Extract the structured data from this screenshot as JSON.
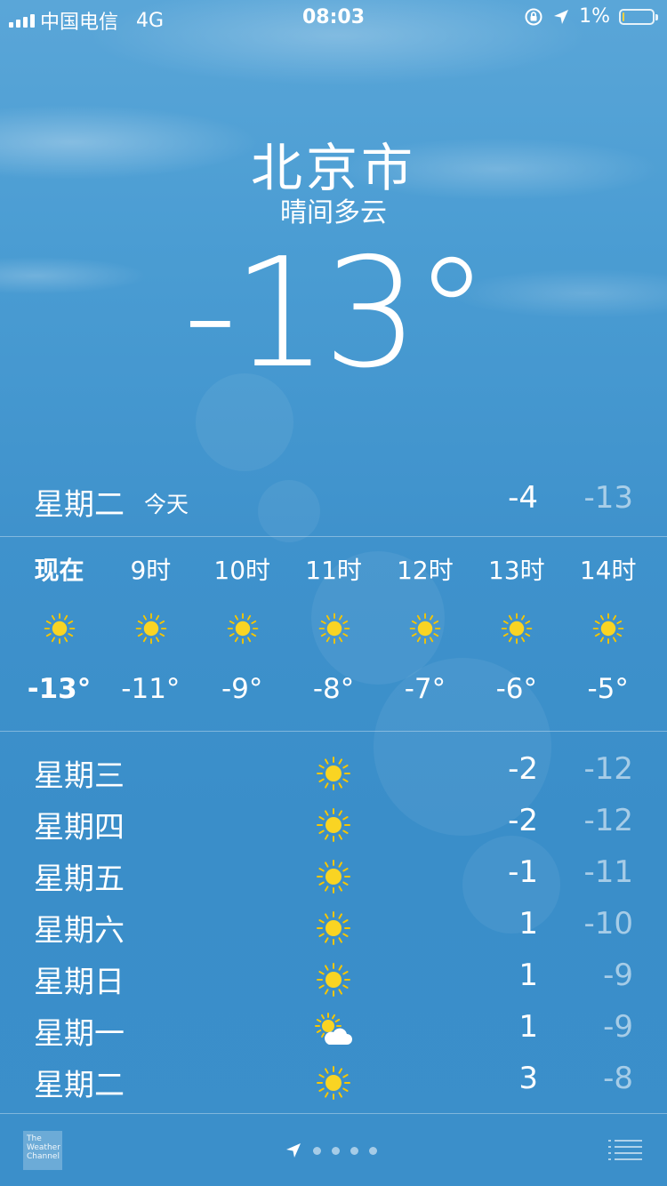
{
  "status_bar": {
    "carrier": "中国电信",
    "network": "4G",
    "time": "08:03",
    "battery": "1%",
    "battery_level": 0.01,
    "icons": [
      "signal-icon",
      "rotation-lock-icon",
      "location-arrow-icon",
      "battery-icon"
    ]
  },
  "location": {
    "city": "北京市",
    "condition": "晴间多云",
    "current_temp": "-13°"
  },
  "today": {
    "day": "星期二",
    "label": "今天",
    "high": "-4",
    "low": "-13"
  },
  "hourly": [
    {
      "time": "现在",
      "icon": "sun-icon",
      "temp": "-13°"
    },
    {
      "time": "9时",
      "icon": "sun-icon",
      "temp": "-11°"
    },
    {
      "time": "10时",
      "icon": "sun-icon",
      "temp": "-9°"
    },
    {
      "time": "11时",
      "icon": "sun-icon",
      "temp": "-8°"
    },
    {
      "time": "12时",
      "icon": "sun-icon",
      "temp": "-7°"
    },
    {
      "time": "13时",
      "icon": "sun-icon",
      "temp": "-6°"
    },
    {
      "time": "14时",
      "icon": "sun-icon",
      "temp": "-5°"
    }
  ],
  "daily": [
    {
      "day": "星期三",
      "icon": "sun-icon",
      "high": "-2",
      "low": "-12"
    },
    {
      "day": "星期四",
      "icon": "sun-icon",
      "high": "-2",
      "low": "-12"
    },
    {
      "day": "星期五",
      "icon": "sun-icon",
      "high": "-1",
      "low": "-11"
    },
    {
      "day": "星期六",
      "icon": "sun-icon",
      "high": "1",
      "low": "-10"
    },
    {
      "day": "星期日",
      "icon": "sun-icon",
      "high": "1",
      "low": "-9"
    },
    {
      "day": "星期一",
      "icon": "partly-cloudy-icon",
      "high": "1",
      "low": "-9"
    },
    {
      "day": "星期二",
      "icon": "sun-icon",
      "high": "3",
      "low": "-8"
    }
  ],
  "bottom_bar": {
    "logo_text": "The Weather Channel",
    "page_count": 4,
    "icons": [
      "weather-channel-logo",
      "location-arrow-icon",
      "list-icon"
    ]
  },
  "colors": {
    "sun": "#f9d423",
    "sun_ray": "#f7c600",
    "low_temp_text": "rgba(255,255,255,0.55)"
  }
}
